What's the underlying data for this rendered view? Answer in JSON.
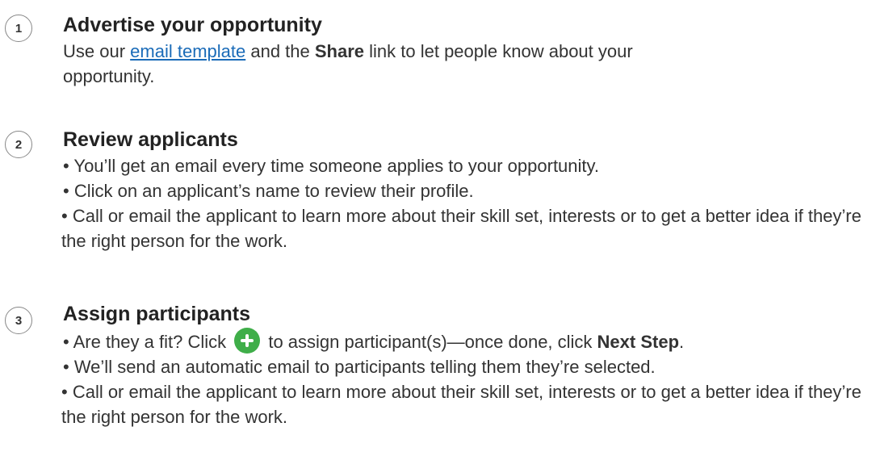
{
  "steps": [
    {
      "number": "1",
      "title": "Advertise your opportunity",
      "text_before_link": "Use our ",
      "link_label": "email template",
      "text_between": " and the ",
      "share_label": "Share",
      "text_after": " link to let people know about your opportunity."
    },
    {
      "number": "2",
      "title": "Review applicants",
      "bullets": [
        "• You’ll get an email every time someone applies to your opportunity.",
        "• Click on an applicant’s name to review their profile.",
        "• Call or email the applicant to learn more about their skill set, interests or to get a better idea if they’re the right person for the work."
      ]
    },
    {
      "number": "3",
      "title": "Assign participants",
      "fit_before_icon": "• Are they a fit?  Click ",
      "fit_after_icon": " to assign participant(s)—once done, click ",
      "next_step_label": "Next Step",
      "fit_end": ".",
      "bullets": [
        "• We’ll send an automatic email to participants telling them they’re selected.",
        "• Call or email the applicant to learn more about their skill set, interests or to get a better idea if they’re the right person for the work."
      ]
    }
  ],
  "icons": {
    "add_icon": "plus-circle-icon",
    "add_icon_color": "#3fae49"
  },
  "colors": {
    "link": "#1a6bb8"
  }
}
